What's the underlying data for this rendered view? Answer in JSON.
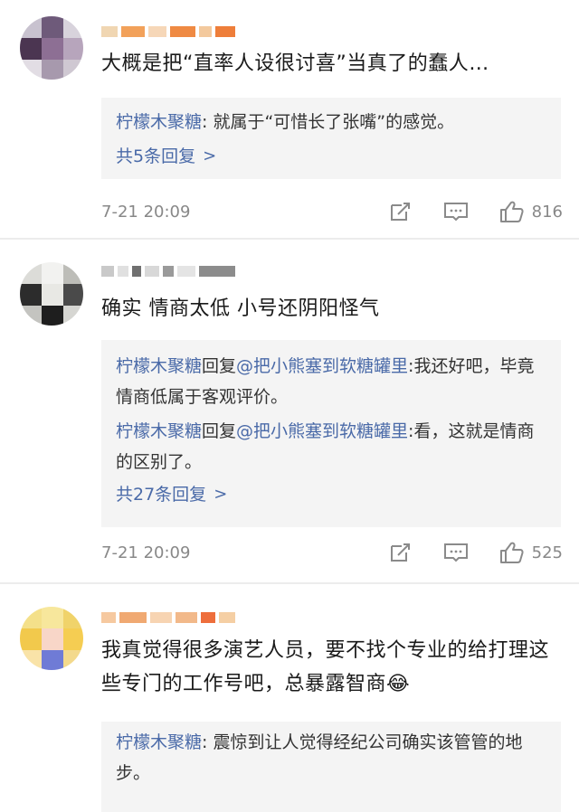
{
  "comments": [
    {
      "text": "大概是把“直率人设很讨喜”当真了的蠢人…",
      "replies": [
        {
          "user": "柠檬木聚糖",
          "body": ": 就属于“可惜长了张嘴”的感觉。"
        }
      ],
      "more_label": "共5条回复",
      "time": "7-21 20:09",
      "likes": "816"
    },
    {
      "text": "确实 情商太低 小号还阴阳怪气",
      "replies": [
        {
          "user": "柠檬木聚糖",
          "verb": "回复",
          "mention": "@把小熊塞到软糖罐里",
          "body": ":我还好吧，毕竟情商低属于客观评价。"
        },
        {
          "user": "柠檬木聚糖",
          "verb": "回复",
          "mention": "@把小熊塞到软糖罐里",
          "body": ":看，这就是情商的区别了。"
        }
      ],
      "more_label": "共27条回复",
      "time": "7-21 20:09",
      "likes": "525"
    },
    {
      "text": "我真觉得很多演艺人员，要不找个专业的给打理这些专门的工作号吧，总暴露智商😂",
      "replies": [
        {
          "user": "柠檬木聚糖",
          "body": ": 震惊到让人觉得经纪公司确实该管管的地步。"
        }
      ]
    }
  ],
  "colors": {
    "link": "#4a6aa8",
    "meta": "#888888",
    "reply_bg": "#f4f4f4"
  }
}
